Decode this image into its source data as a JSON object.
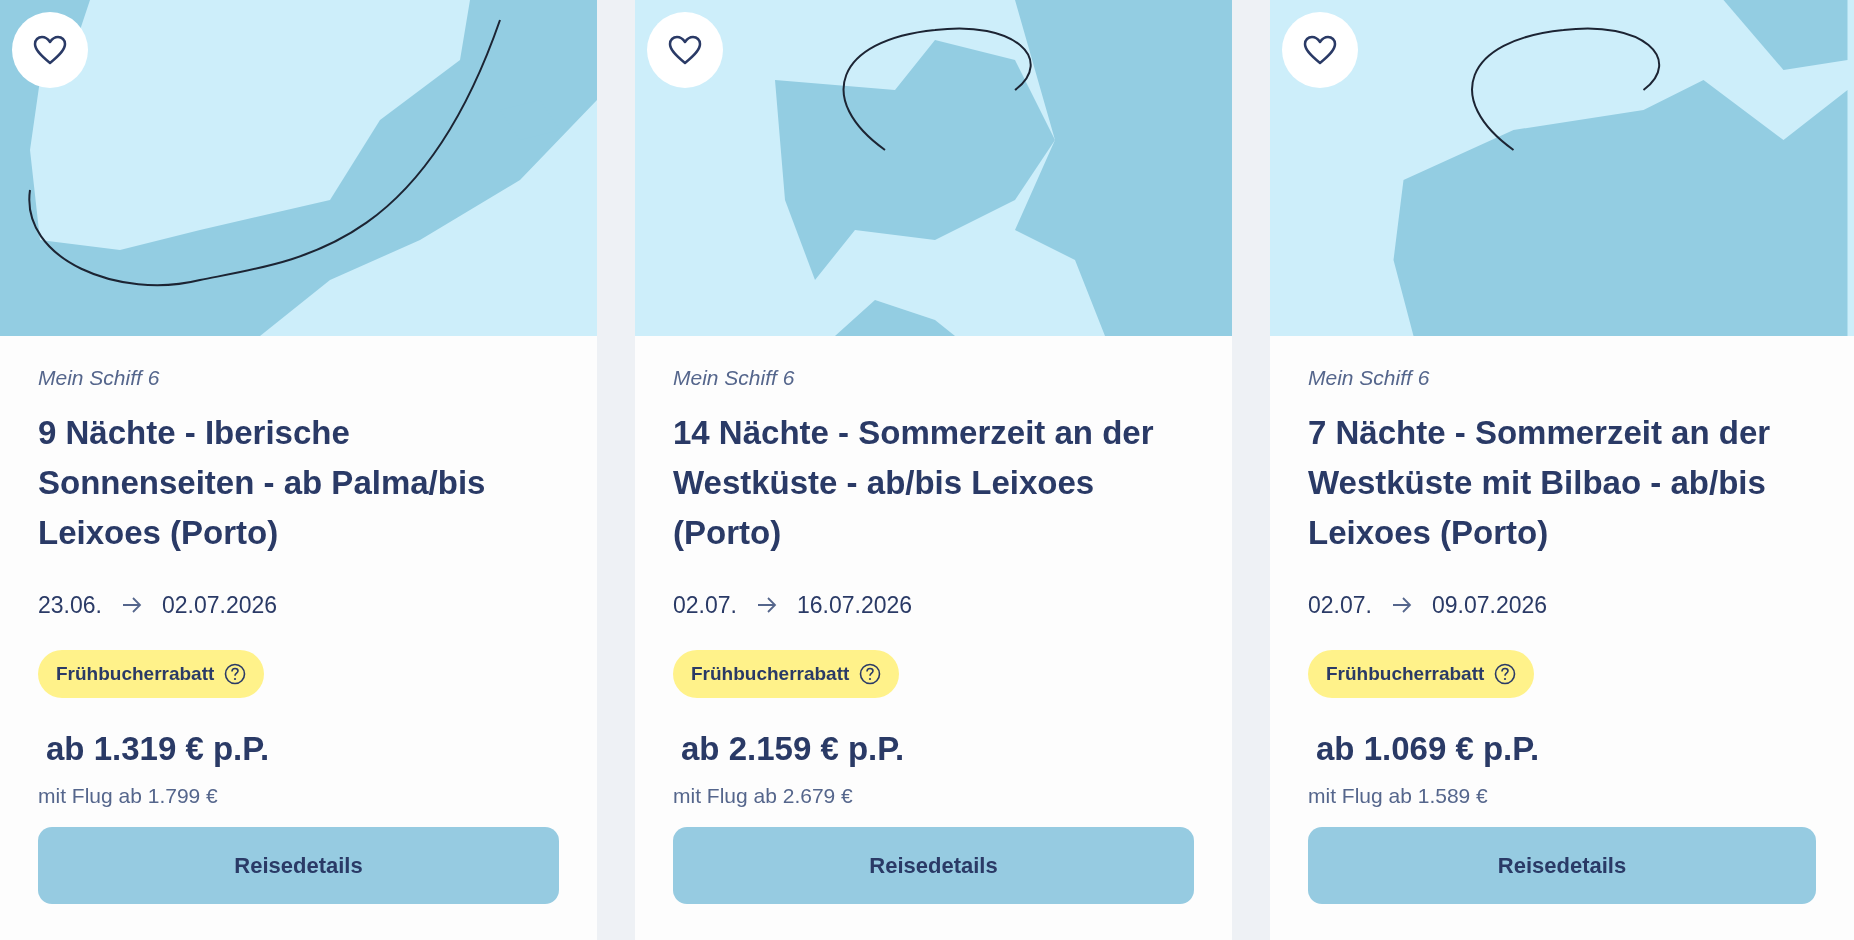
{
  "cards": [
    {
      "ship": "Mein Schiff 6",
      "title": "9 Nächte - Iberische Sonnenseiten - ab Palma/bis Leixoes (Porto)",
      "date_from": "23.06.",
      "date_to": "02.07.2026",
      "badge": "Frühbucherrabatt",
      "price": "ab 1.319 € p.P.",
      "flight_price": "mit Flug ab 1.799 €",
      "button": "Reisedetails"
    },
    {
      "ship": "Mein Schiff 6",
      "title": "14 Nächte - Sommerzeit an der Westküste - ab/bis Leixoes (Porto)",
      "date_from": "02.07.",
      "date_to": "16.07.2026",
      "badge": "Frühbucherrabatt",
      "price": "ab 2.159 € p.P.",
      "flight_price": "mit Flug ab 2.679 €",
      "button": "Reisedetails"
    },
    {
      "ship": "Mein Schiff 6",
      "title": "7 Nächte - Sommerzeit an der Westküste mit Bilbao - ab/bis Leixoes (Porto)",
      "date_from": "02.07.",
      "date_to": "09.07.2026",
      "badge": "Frühbucherrabatt",
      "price": "ab 1.069 € p.P.",
      "flight_price": "mit Flug ab 1.589 €",
      "button": "Reisedetails"
    }
  ]
}
